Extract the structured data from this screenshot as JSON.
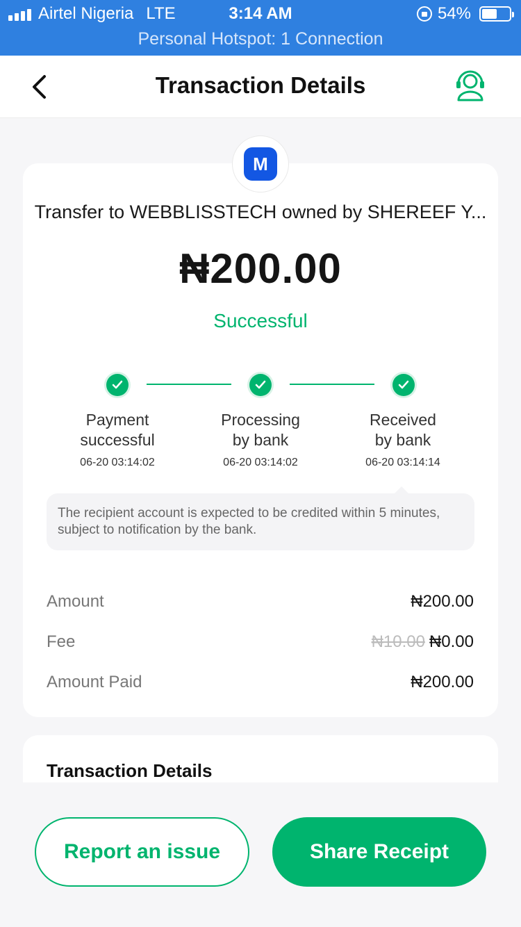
{
  "status_bar": {
    "carrier": "Airtel Nigeria",
    "network": "LTE",
    "time": "3:14 AM",
    "battery_percent": "54%",
    "battery_level": 0.54,
    "hotspot": "Personal Hotspot: 1 Connection"
  },
  "header": {
    "title": "Transaction Details",
    "back_icon": "chevron-left-icon",
    "support_icon": "headset-support-icon"
  },
  "summary": {
    "logo_letter": "M",
    "recipient": "Transfer to WEBBLISSTECH owned by SHEREEF Y...",
    "amount": "₦200.00",
    "status": "Successful"
  },
  "steps": [
    {
      "label_line1": "Payment",
      "label_line2": "successful",
      "time": "06-20 03:14:02"
    },
    {
      "label_line1": "Processing",
      "label_line2": "by bank",
      "time": "06-20 03:14:02"
    },
    {
      "label_line1": "Received",
      "label_line2": "by bank",
      "time": "06-20 03:14:14"
    }
  ],
  "note": "The recipient account is expected to be credited within 5 minutes, subject to notification by the bank.",
  "rows": {
    "amount_label": "Amount",
    "amount_value": "₦200.00",
    "fee_label": "Fee",
    "fee_original": "₦10.00",
    "fee_value": "₦0.00",
    "paid_label": "Amount Paid",
    "paid_value": "₦200.00"
  },
  "details_section": {
    "title": "Transaction Details"
  },
  "actions": {
    "report": "Report an issue",
    "share": "Share Receipt"
  },
  "colors": {
    "status_bar": "#2f80e0",
    "accent_green": "#00b46e",
    "logo_blue": "#1357e3"
  }
}
